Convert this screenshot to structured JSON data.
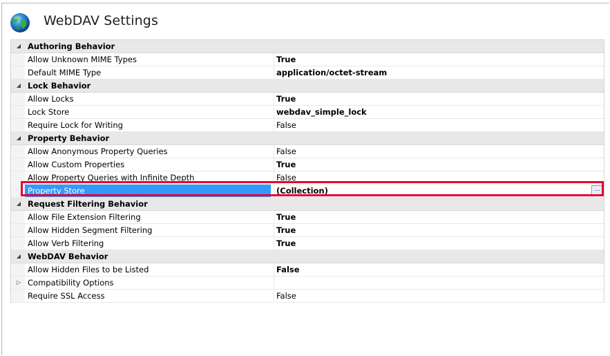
{
  "header": {
    "title": "WebDAV Settings"
  },
  "grid": {
    "rows": [
      {
        "type": "category",
        "label": "Authoring Behavior"
      },
      {
        "type": "prop",
        "label": "Allow Unknown MIME Types",
        "value": "True",
        "bold": true
      },
      {
        "type": "prop",
        "label": "Default MIME Type",
        "value": "application/octet-stream",
        "bold": true
      },
      {
        "type": "category",
        "label": "Lock Behavior"
      },
      {
        "type": "prop",
        "label": "Allow Locks",
        "value": "True",
        "bold": true
      },
      {
        "type": "prop",
        "label": "Lock Store",
        "value": "webdav_simple_lock",
        "bold": true
      },
      {
        "type": "prop",
        "label": "Require Lock for Writing",
        "value": "False",
        "bold": false
      },
      {
        "type": "category",
        "label": "Property Behavior"
      },
      {
        "type": "prop",
        "label": "Allow Anonymous Property Queries",
        "value": "False",
        "bold": false
      },
      {
        "type": "prop",
        "label": "Allow Custom Properties",
        "value": "True",
        "bold": true
      },
      {
        "type": "prop",
        "label": "Allow Property Queries with Infinite Depth",
        "value": "False",
        "bold": false
      },
      {
        "type": "prop",
        "label": "Property Store",
        "value": "(Collection)",
        "bold": true,
        "selected": true,
        "button": "..."
      },
      {
        "type": "category",
        "label": "Request Filtering Behavior"
      },
      {
        "type": "prop",
        "label": "Allow File Extension Filtering",
        "value": "True",
        "bold": true
      },
      {
        "type": "prop",
        "label": "Allow Hidden Segment Filtering",
        "value": "True",
        "bold": true
      },
      {
        "type": "prop",
        "label": "Allow Verb Filtering",
        "value": "True",
        "bold": true
      },
      {
        "type": "category",
        "label": "WebDAV Behavior"
      },
      {
        "type": "prop",
        "label": "Allow Hidden Files to be Listed",
        "value": "False",
        "bold": true
      },
      {
        "type": "prop",
        "label": "Compatibility Options",
        "value": "",
        "bold": false,
        "collapsed": true
      },
      {
        "type": "prop",
        "label": "Require SSL Access",
        "value": "False",
        "bold": false
      }
    ]
  },
  "colors": {
    "selection": "#3399ff",
    "highlight_border": "#e4002b",
    "category_background": "#e8e8e8"
  },
  "icons": {
    "app_icon": "globe-icon",
    "expanded": "expanded-triangle-icon",
    "collapsed": "collapsed-triangle-icon"
  }
}
